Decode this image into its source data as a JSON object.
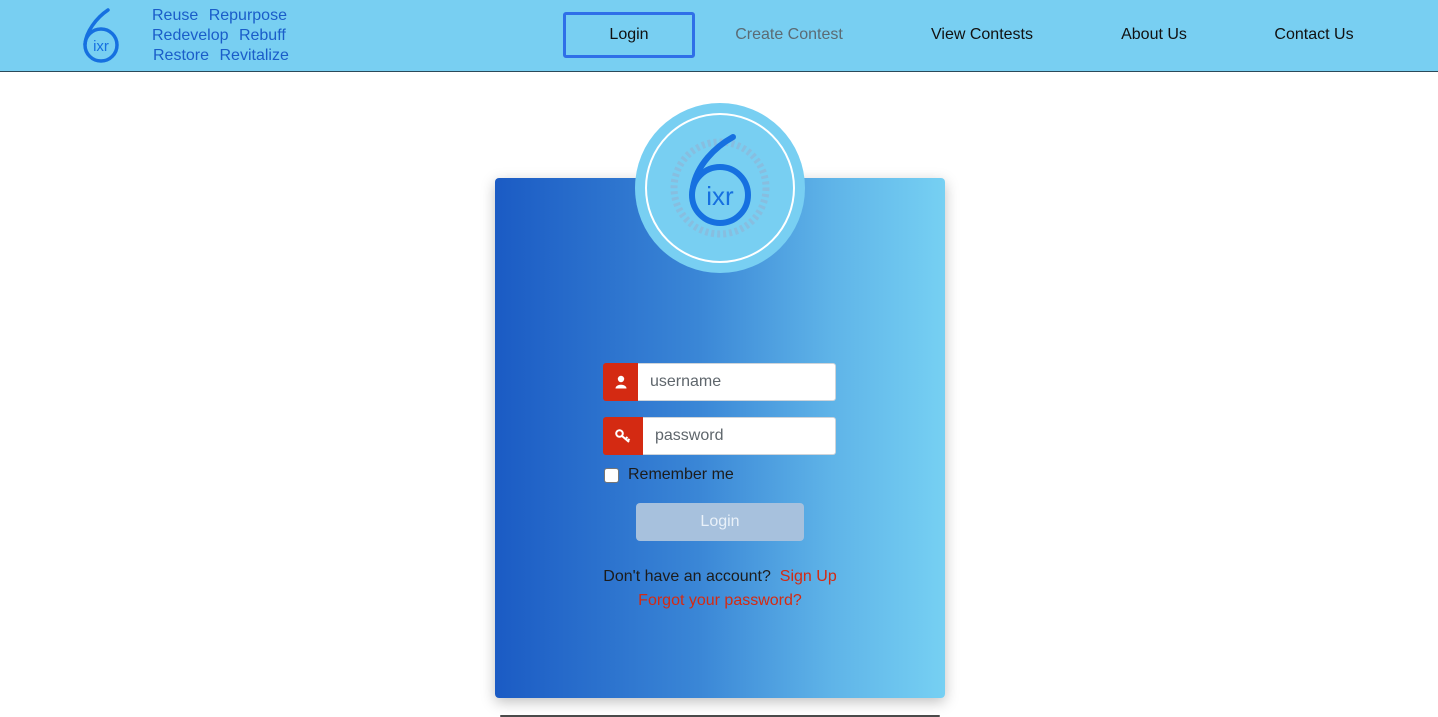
{
  "header": {
    "logo_text": "ixr",
    "tagline": {
      "row1": [
        "Reuse",
        "Repurpose"
      ],
      "row2": [
        "Redevelop",
        "Rebuff"
      ],
      "row3": [
        "Restore",
        "Revitalize"
      ]
    },
    "nav": {
      "login": "Login",
      "create_contest": "Create Contest",
      "view_contests": "View Contests",
      "about_us": "About Us",
      "contact_us": "Contact Us"
    }
  },
  "login_form": {
    "username_placeholder": "username",
    "password_placeholder": "password",
    "remember_label": "Remember me",
    "submit_label": "Login",
    "signup_prompt": "Don't have an account?",
    "signup_link": "Sign Up",
    "forgot_link": "Forgot your password?"
  },
  "colors": {
    "navbar": "#78cff2",
    "accent_red": "#d42a12",
    "brand_blue": "#1a5dc9"
  },
  "icons": {
    "username": "user-icon",
    "password": "key-icon"
  }
}
